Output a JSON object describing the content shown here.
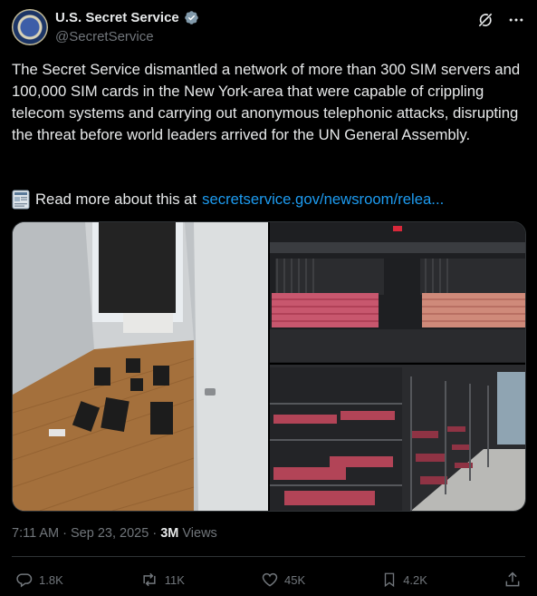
{
  "author": {
    "name": "U.S. Secret Service",
    "handle": "@SecretService",
    "verified": true
  },
  "tweet": {
    "text": "The Secret Service dismantled a network of more than 300 SIM servers and 100,000 SIM cards in the New York-area that were capable of crippling telecom systems and carrying out anonymous telephonic attacks, disrupting the threat before world leaders arrived for the UN General Assembly.",
    "read_more_prefix": "Read more about this at",
    "link_text": "secretservice.gov/newsroom/relea..."
  },
  "meta": {
    "time": "7:11 AM",
    "date": "Sep 23, 2025",
    "views_count": "3M",
    "views_label": "Views"
  },
  "actions": {
    "replies": "1.8K",
    "reposts": "11K",
    "likes": "45K",
    "bookmarks": "4.2K"
  },
  "colors": {
    "background": "#000000",
    "text": "#e7e9ea",
    "muted": "#71767b",
    "link": "#1d9bf0",
    "border": "#2f3336"
  },
  "icons": [
    "verified-badge-icon",
    "grok-icon",
    "more-icon",
    "document-icon",
    "reply-icon",
    "repost-icon",
    "like-icon",
    "bookmark-icon",
    "share-icon"
  ]
}
